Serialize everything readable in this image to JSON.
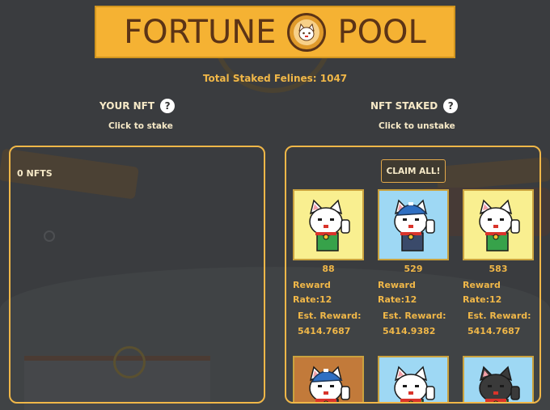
{
  "banner": {
    "word_left": "FORTUNE",
    "word_right": "POOL",
    "logo_icon": "lucky-cat-coin-icon"
  },
  "total_staked": "Total Staked Felines: 1047",
  "your_nft": {
    "title": "YOUR NFT",
    "subtitle": "Click to stake",
    "count_label": "0 NFTS"
  },
  "nft_staked": {
    "title": "NFT STAKED",
    "subtitle": "Click to unstake",
    "claim_label": "CLAIM ALL!",
    "cards": [
      {
        "id": "88",
        "reward": "Reward",
        "rate": "Rate:12",
        "est": "Est. Reward:",
        "value": "5414.7687",
        "bg": "#f9ef90",
        "cap": "none"
      },
      {
        "id": "529",
        "reward": "Reward",
        "rate": "Rate:12",
        "est": "Est. Reward:",
        "value": "5414.9382",
        "bg": "#9ed8f4",
        "cap": "blue"
      },
      {
        "id": "583",
        "reward": "Reward",
        "rate": "Rate:12",
        "est": "Est. Reward:",
        "value": "5414.7687",
        "bg": "#f9ef90",
        "cap": "none"
      },
      {
        "bg": "#c27a3a",
        "cap": "blue"
      },
      {
        "bg": "#9ed8f4",
        "cap": "none"
      },
      {
        "bg": "#9ed8f4",
        "cap": "black"
      }
    ]
  },
  "colors": {
    "accent": "#f0b748",
    "banner_bg": "#f5b233",
    "banner_text": "#5c3416",
    "background": "#3a3c3f"
  }
}
